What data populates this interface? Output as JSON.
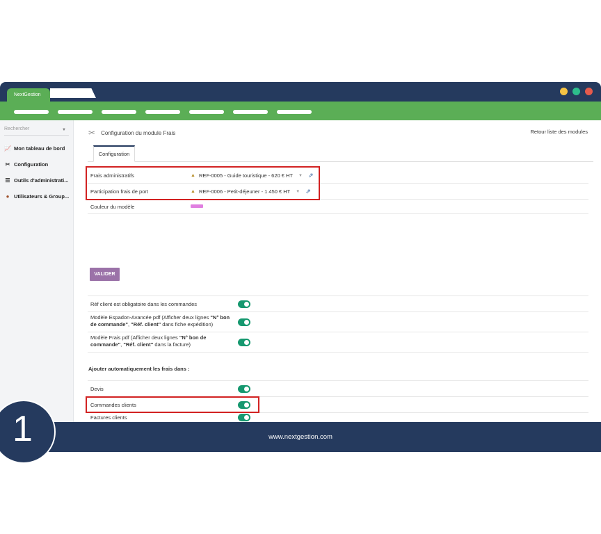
{
  "window": {
    "tab_title": "NextGestion",
    "controls": {
      "yellow": "#f5c344",
      "green": "#2dbd8c",
      "red": "#e55a4c"
    }
  },
  "colors": {
    "navy": "#253a5e",
    "green": "#5bae56",
    "toggle_on": "#16986f",
    "highlight_red": "#d22222",
    "button_purple": "#9b72a8"
  },
  "sidebar": {
    "search_placeholder": "Rechercher",
    "items": [
      {
        "icon": "chart-icon",
        "label": "Mon tableau de bord"
      },
      {
        "icon": "tools-icon",
        "label": "Configuration"
      },
      {
        "icon": "server-icon",
        "label": "Outils d'administrati..."
      },
      {
        "icon": "users-icon",
        "label": "Utilisateurs & Group..."
      }
    ]
  },
  "main": {
    "title": "Configuration du module Frais",
    "back_link": "Retour liste des modules",
    "tab": "Configuration",
    "settings": [
      {
        "label": "Frais administratifs",
        "value": "REF-0005 - Guide touristique - 620 € HT"
      },
      {
        "label": "Participation frais de port",
        "value": "REF-0006 - Petit-déjeuner - 1 450 € HT"
      }
    ],
    "color_label": "Couleur du modèle",
    "color_value": "#e07fe0",
    "validate_label": "VALIDER",
    "options": {
      "ref_required": "Réf client est obligatoire dans les commandes",
      "espadon_pre": "Modèle Espadon-Avancée pdf (Afficher deux lignes ",
      "espadon_b1": "\"N° bon de commande\"",
      "espadon_mid": ", ",
      "espadon_b2": "\"Réf. client\"",
      "espadon_post": " dans fiche expédition)",
      "frais_pre": "Modèle Frais pdf (Afficher deux lignes ",
      "frais_b1": "\"N° bon de commande\"",
      "frais_mid": ", ",
      "frais_b2": "\"Réf. client\"",
      "frais_post": " dans la facture)"
    },
    "auto_section": "Ajouter automatiquement les frais dans :",
    "auto_items": [
      "Devis",
      "Commandes clients",
      "Factures clients"
    ]
  },
  "footer": {
    "url": "www.nextgestion.com"
  },
  "step_number": "1"
}
